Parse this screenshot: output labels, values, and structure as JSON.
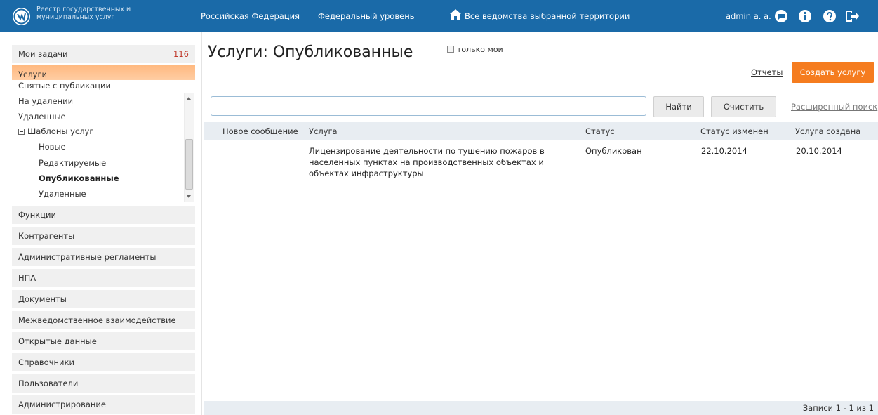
{
  "app": {
    "logo_text": "Реестр государственных и муниципальных услуг",
    "brand_color": "#1a6aa8",
    "accent_color": "#f57c1f"
  },
  "topbar": {
    "territory": "Российская Федерация",
    "level": "Федеральный уровень",
    "agencies": "Все ведомства выбранной территории",
    "user": "admin a. a.",
    "icons": [
      "home-icon",
      "chat-icon",
      "info-icon",
      "help-icon",
      "logout-icon"
    ]
  },
  "sidebar": {
    "my_tasks": {
      "label": "Мои задачи",
      "count": "116"
    },
    "services": {
      "label": "Услуги"
    },
    "submenu": {
      "unpublished": "Снятые с публикации",
      "on_deletion": "На удалении",
      "deleted": "Удаленные",
      "templates": "Шаблоны услуг",
      "tpl_new": "Новые",
      "tpl_editing": "Редактируемые",
      "tpl_published": "Опубликованные",
      "tpl_deleted": "Удаленные"
    },
    "items": [
      "Функции",
      "Контрагенты",
      "Административные регламенты",
      "НПА",
      "Документы",
      "Межведомственное взаимодействие",
      "Открытые данные",
      "Справочники",
      "Пользователи",
      "Администрирование"
    ]
  },
  "main": {
    "title": "Услуги: Опубликованные",
    "only_mine": "только мои",
    "reports": "Отчеты",
    "create_button": "Создать услугу",
    "search": {
      "value": "",
      "placeholder": ""
    },
    "find_button": "Найти",
    "clear_button": "Очистить",
    "advanced_search": "Расширенный поиск",
    "table": {
      "columns": [
        "Новое сообщение",
        "Услуга",
        "Статус",
        "Статус изменен",
        "Услуга создана"
      ],
      "rows": [
        {
          "new_message": "",
          "service": "Лицензирование деятельности по тушению пожаров в населенных пунктах на производственных объектах и объектах инфраструктуры",
          "status": "Опубликован",
          "status_changed": "22.10.2014",
          "created": "20.10.2014"
        }
      ]
    },
    "records": "Записи 1 - 1 из 1"
  }
}
